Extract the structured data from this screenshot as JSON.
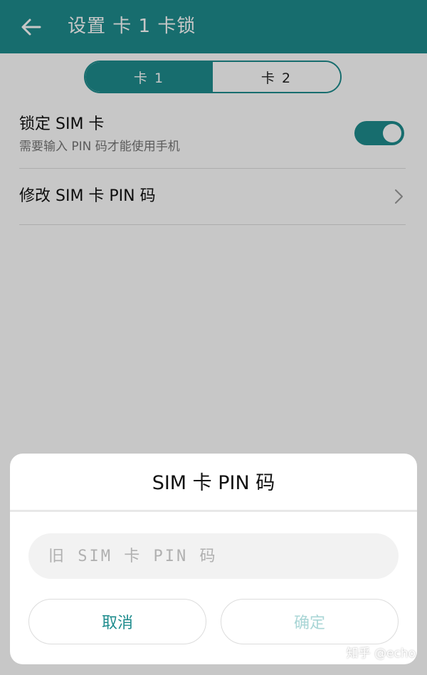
{
  "colors": {
    "accent": "#1e8c8d",
    "accent_disabled": "#a9d6d6",
    "scrim": "#0000003a"
  },
  "header": {
    "title": "设置 卡 1 卡锁",
    "back_icon": "arrow-left-icon"
  },
  "card_tabs": {
    "tab1": "卡 1",
    "tab2": "卡 2",
    "selected": "卡 1"
  },
  "settings": {
    "lock_sim": {
      "title": "锁定 SIM 卡",
      "subtitle": "需要输入 PIN 码才能使用手机",
      "enabled": true
    },
    "change_pin": {
      "title": "修改 SIM 卡 PIN 码",
      "icon": "chevron-right-icon"
    }
  },
  "dialog": {
    "title": "SIM 卡 PIN 码",
    "input_placeholder": "旧 SIM 卡 PIN 码",
    "input_value": "",
    "cancel_label": "取消",
    "confirm_label": "确定",
    "confirm_enabled": false
  },
  "watermark": "知乎 @echo"
}
